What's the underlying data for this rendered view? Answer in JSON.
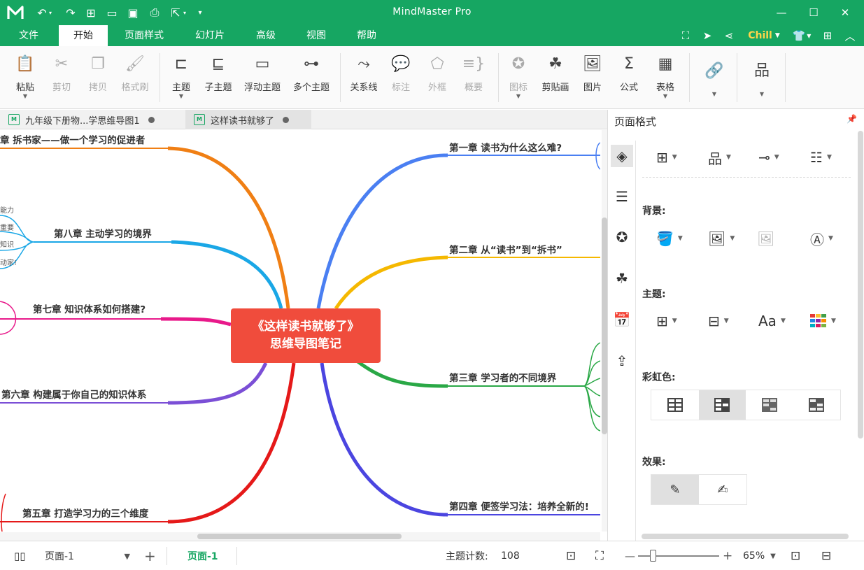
{
  "app": {
    "title": "MindMaster Pro",
    "accent_color": "#16a662",
    "quick_access": [
      "undo-icon",
      "redo-icon",
      "new-icon",
      "open-icon",
      "save-icon",
      "print-icon",
      "export-icon",
      "customize-icon"
    ]
  },
  "menu": {
    "items": [
      "文件",
      "开始",
      "页面样式",
      "幻灯片",
      "高级",
      "视图",
      "帮助"
    ],
    "active": "开始",
    "user": "Chill"
  },
  "ribbon": {
    "paste": "粘贴",
    "cut": "剪切",
    "copy": "拷贝",
    "format_painter": "格式刷",
    "topic": "主题",
    "subtopic": "子主题",
    "floating_topic": "浮动主题",
    "multiple_topics": "多个主题",
    "relationship": "关系线",
    "callout": "标注",
    "boundary": "外框",
    "summary": "概要",
    "icon": "图标",
    "clipart": "剪贴画",
    "picture": "图片",
    "formula": "公式",
    "table": "表格"
  },
  "tabs": [
    {
      "label": "九年级下册物...学思维导图1"
    },
    {
      "label": "这样读书就够了"
    }
  ],
  "mindmap": {
    "central_line1": "《这样读书就够了》",
    "central_line2": "思维导图笔记",
    "branches": {
      "ch9": {
        "label": "章 拆书家——做一个学习的促进者",
        "color": "#f07f14"
      },
      "ch8": {
        "label": "第八章 主动学习的境界",
        "color": "#1aa7e6"
      },
      "ch7": {
        "label": "第七章 知识体系如何搭建?",
        "color": "#e8198a"
      },
      "ch6": {
        "label": "第六章 构建属于你自己的知识体系",
        "color": "#7b4fd6"
      },
      "ch5": {
        "label": "第五章 打造学习力的三个维度",
        "color": "#e51919"
      },
      "ch1": {
        "label": "第一章 读书为什么这么难?",
        "color": "#4a7ff2"
      },
      "ch2": {
        "label": "第二章 从“读书”到“拆书”",
        "color": "#f5b800"
      },
      "ch3": {
        "label": "第三章 学习者的不同境界",
        "color": "#2aa846"
      },
      "ch4": {
        "label": "第四章 便签学习法：培养全新的!",
        "color": "#4b45e0"
      }
    },
    "ch8_subs": [
      "能力",
      "重要",
      "知识",
      "动家!"
    ]
  },
  "panel": {
    "title": "页面格式",
    "background_label": "背景:",
    "topic_label": "主题:",
    "rainbow_label": "彩虹色:",
    "effect_label": "效果:"
  },
  "status": {
    "page_select": "页面-1",
    "page_tab": "页面-1",
    "topic_count_label": "主题计数:",
    "topic_count": "108",
    "zoom": "65%"
  }
}
